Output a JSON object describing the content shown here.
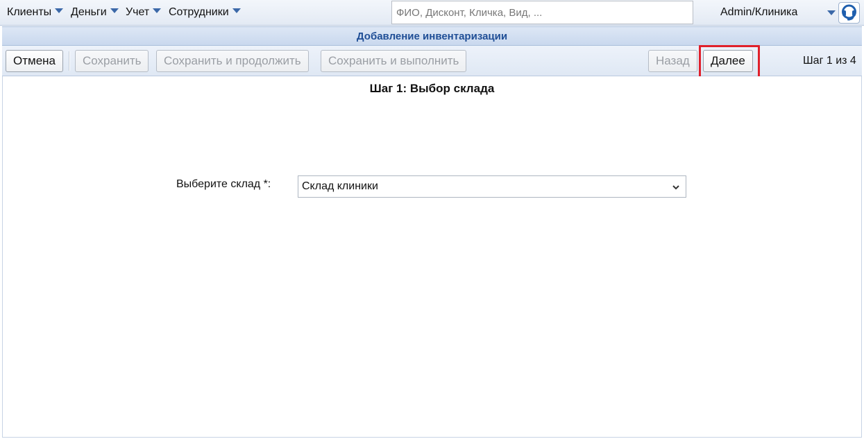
{
  "menu": {
    "items": [
      {
        "label": "Клиенты"
      },
      {
        "label": "Деньги"
      },
      {
        "label": "Учет"
      },
      {
        "label": "Сотрудники"
      }
    ]
  },
  "search": {
    "placeholder": "ФИО, Дисконт, Кличка, Вид, ...",
    "value": ""
  },
  "user": {
    "label": "Admin/Клиника"
  },
  "page": {
    "title": "Добавление инвентаризации"
  },
  "toolbar": {
    "cancel_label": "Отмена",
    "save_label": "Сохранить",
    "save_continue_label": "Сохранить и продолжить",
    "save_execute_label": "Сохранить и выполнить",
    "back_label": "Назад",
    "next_label": "Далее",
    "step_indicator": "Шаг 1 из 4"
  },
  "step": {
    "title": "Шаг 1: Выбор склада",
    "warehouse_label": "Выберите склад *:",
    "warehouse_value": "Склад клиники"
  },
  "colors": {
    "accent": "#1f4e96",
    "highlight": "#e0202b",
    "caret": "#3b68a8"
  }
}
